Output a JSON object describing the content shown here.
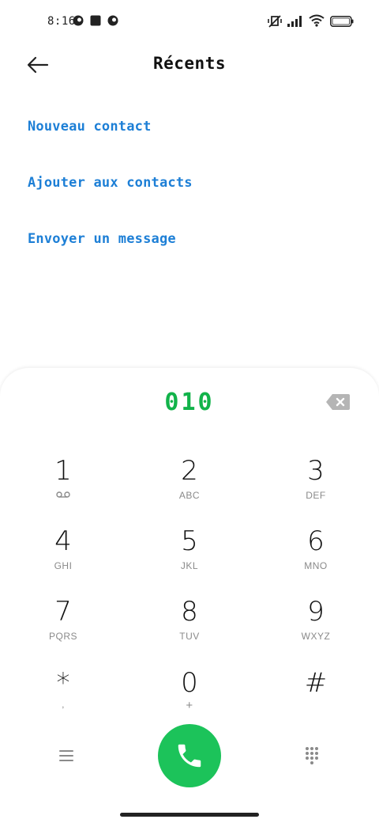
{
  "status_bar": {
    "time": "8:16"
  },
  "header": {
    "title": "Récents"
  },
  "actions": [
    {
      "label": "Nouveau contact"
    },
    {
      "label": "Ajouter aux contacts"
    },
    {
      "label": "Envoyer un message"
    }
  ],
  "dialpad": {
    "number": "010",
    "keys": [
      {
        "digit": "1",
        "letters": ""
      },
      {
        "digit": "2",
        "letters": "ABC"
      },
      {
        "digit": "3",
        "letters": "DEF"
      },
      {
        "digit": "4",
        "letters": "GHI"
      },
      {
        "digit": "5",
        "letters": "JKL"
      },
      {
        "digit": "6",
        "letters": "MNO"
      },
      {
        "digit": "7",
        "letters": "PQRS"
      },
      {
        "digit": "8",
        "letters": "TUV"
      },
      {
        "digit": "9",
        "letters": "WXYZ"
      },
      {
        "digit": "*",
        "letters": ","
      },
      {
        "digit": "0",
        "letters": "+"
      },
      {
        "digit": "#",
        "letters": ""
      }
    ]
  },
  "colors": {
    "accent_blue": "#1d7fd6",
    "call_green": "#1cc35a",
    "number_green": "#12b34a"
  },
  "icons": [
    "back-arrow-icon",
    "backspace-icon",
    "voicemail-icon",
    "menu-icon",
    "phone-icon",
    "dialpad-grid-icon"
  ]
}
